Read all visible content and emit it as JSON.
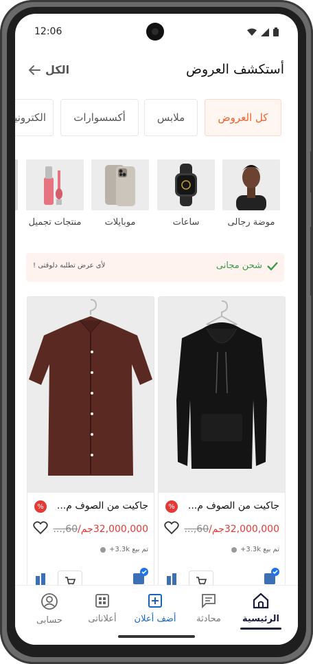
{
  "status": {
    "time": "12:06"
  },
  "header": {
    "title": "أستكشف العروض",
    "all_link": "الكل"
  },
  "tabs": [
    "كل العروض",
    "ملابس",
    "أكسسوارات",
    "الكترونيات"
  ],
  "categories": [
    "موضة رجالى",
    "ساعات",
    "موبايلات",
    "منتجات تجميل"
  ],
  "banner": {
    "shipping": "شحن مجانى",
    "note": "لأى عرض تطلبه دلوقتى !"
  },
  "products": [
    {
      "name": "جاكيت من الصوف م...",
      "price": "32,000,000جم/",
      "old_price": "60,...",
      "sold": "تم بيع 3.3k+"
    },
    {
      "name": "جاكيت من الصوف م...",
      "price": "32,000,000جم/",
      "old_price": "60,...",
      "sold": "تم بيع 3.3k+"
    }
  ],
  "nav": {
    "home": "الرئيسية",
    "chat": "محادثة",
    "add": "أضف أعلان",
    "my_ads": "أعلاناتى",
    "account": "حسابى"
  },
  "colors": {
    "accent": "#f0612d",
    "price": "#e53935",
    "success": "#3a9a4a",
    "link": "#1565c0"
  }
}
